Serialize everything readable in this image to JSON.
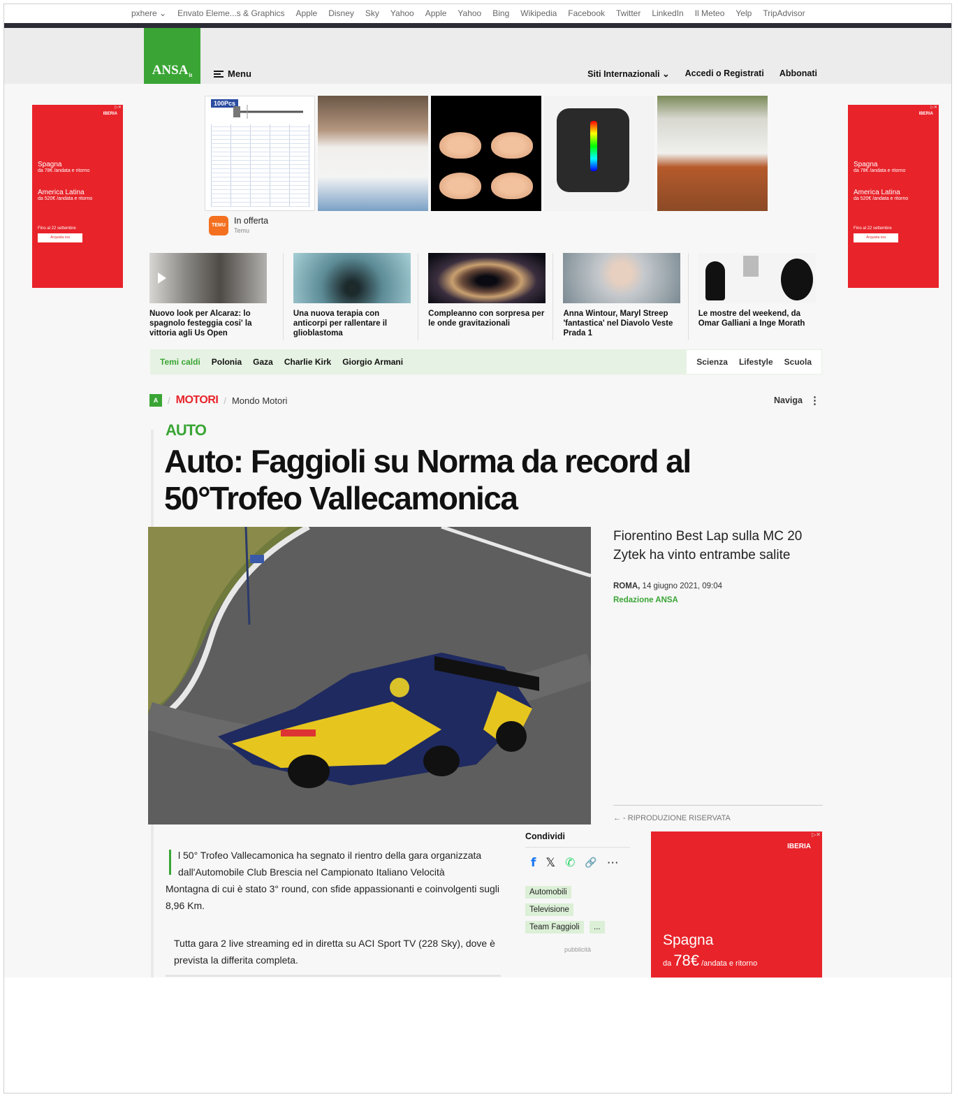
{
  "bookmarks": [
    "pxhere ⌄",
    "Envato Eleme...s & Graphics",
    "Apple",
    "Disney",
    "Sky",
    "Yahoo",
    "Apple",
    "Yahoo",
    "Bing",
    "Wikipedia",
    "Facebook",
    "Twitter",
    "LinkedIn",
    "Il Meteo",
    "Yelp",
    "TripAdvisor"
  ],
  "header": {
    "logo": "ANSA",
    "logo_sup": "it",
    "menu_label": "Menu",
    "intl_label": "Siti Internazionali ⌄",
    "login_label": "Accedi o Registrati",
    "subscribe_label": "Abbonati"
  },
  "side_ad": {
    "brand": "IBERIA",
    "line1": "Spagna",
    "line1b": "da 78€ /andata e ritorno",
    "line2": "America Latina",
    "line2b": "da 520€ /andata e ritorno",
    "line3": "Fino al 22 settembre",
    "button": "Acquista ora"
  },
  "top_ad": {
    "badge": "100Pcs",
    "offer_title": "In offerta",
    "offer_brand": "Temu",
    "temu_logo": "TEMU"
  },
  "news": [
    {
      "title": "Nuovo look per Alcaraz: lo spagnolo festeggia cosi' la vittoria agli Us Open"
    },
    {
      "title": "Una nuova terapia con anticorpi per rallentare il glioblastoma"
    },
    {
      "title": "Compleanno con sorpresa per le onde gravitazionali"
    },
    {
      "title": "Anna Wintour, Maryl Streep 'fantastica' nel Diavolo Veste Prada 1"
    },
    {
      "title": "Le mostre del weekend, da Omar Galliani a Inge Morath"
    }
  ],
  "topics": {
    "label": "Temi caldi",
    "items": [
      "Polonia",
      "Gaza",
      "Charlie Kirk",
      "Giorgio Armani"
    ],
    "right": [
      "Scienza",
      "Lifestyle",
      "Scuola"
    ]
  },
  "breadcrumb": {
    "home": "A",
    "section": "MOTORI",
    "subsection": "Mondo Motori",
    "naviga": "Naviga"
  },
  "article": {
    "kicker": "AUTO",
    "headline": "Auto: Faggioli su Norma da record al 50°Trofeo Vallecamonica",
    "subtitle": "Fiorentino Best Lap sulla MC 20 Zytek ha vinto entrambe salite",
    "place": "ROMA,",
    "date": "14 giugno 2021, 09:04",
    "author": "Redazione ANSA",
    "reproduction": "← - RIPRODUZIONE RISERVATA",
    "p1_first": "l 50° Trofeo Vallecamonica ha segnato il rientro della gara organizzata dall'Automobile Club Brescia nel Campionato Italiano Velocità",
    "p1_rest": "Montagna di cui è stato 3° round, con sfide appassionanti e coinvolgenti sugli 8,96 Km.",
    "p2": "Tutta gara 2 live streaming ed in diretta su ACI Sport TV (228 Sky), dove è prevista la differita completa."
  },
  "share": {
    "label": "Condividi",
    "icons": [
      "f",
      "𝕏",
      "✆",
      "🔗",
      "⋯"
    ],
    "tags": [
      "Automobili",
      "Televisione",
      "Team Faggioli"
    ],
    "more": "...",
    "pub": "pubblicità"
  },
  "box_ad": {
    "brand": "IBERIA",
    "line1": "Spagna",
    "prefix": "da",
    "price": "78€",
    "suffix": "/andata e ritorno"
  },
  "colors": {
    "accent": "#3aa535",
    "section_red": "#e8232a",
    "ad_red": "#e8232a"
  }
}
